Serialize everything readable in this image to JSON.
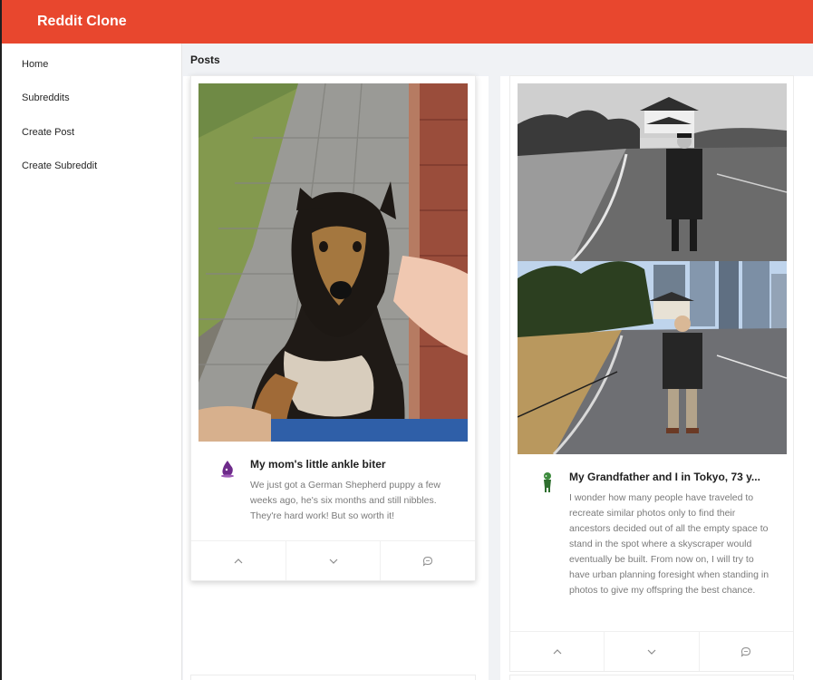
{
  "header": {
    "brand": "Reddit Clone"
  },
  "sidebar": {
    "items": [
      {
        "label": "Home"
      },
      {
        "label": "Subreddits"
      },
      {
        "label": "Create Post"
      },
      {
        "label": "Create Subreddit"
      }
    ]
  },
  "main": {
    "section_title": "Posts",
    "posts": [
      {
        "title": "My mom's little ankle biter",
        "body": "We just got a German Shepherd puppy a few weeks ago, he's six months and still nibbles. They're hard work! But so worth it!",
        "avatar_icon": "purple-creature-icon",
        "photo_description": "puppy-photo"
      },
      {
        "title": "My Grandfather and I in Tokyo, 73 y...",
        "body": "I wonder how many people have traveled to recreate similar photos only to find their ancestors decided out of all the empty space to stand in the spot where a skyscraper would eventually be built. From now on, I will try to have urban planning foresight when standing in photos to give my offspring the best chance.",
        "avatar_icon": "green-creature-icon",
        "photo_description": "tokyo-then-and-now-photo"
      }
    ],
    "actions": {
      "upvote_icon": "chevron-up-icon",
      "downvote_icon": "chevron-down-icon",
      "comment_icon": "comment-icon"
    }
  },
  "colors": {
    "header": "#e8472e",
    "sidebar": "#ffffff",
    "content": "#f0f2f5",
    "muted_text": "#7a7a7a"
  }
}
